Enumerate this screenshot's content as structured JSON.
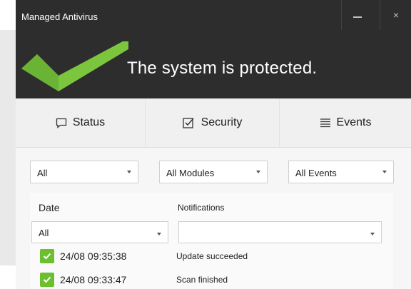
{
  "window": {
    "title": "Managed Antivirus",
    "minimize_label": "",
    "close_label": "×"
  },
  "banner": {
    "status_text": "The system is protected.",
    "accent": "#7cc63e"
  },
  "tabs": [
    {
      "label": "Status",
      "icon": "speech-bubble-icon"
    },
    {
      "label": "Security",
      "icon": "checkbox-icon"
    },
    {
      "label": "Events",
      "icon": "list-icon"
    }
  ],
  "filters": {
    "time": "All",
    "modules": "All Modules",
    "events": "All Events"
  },
  "table": {
    "headers": {
      "date": "Date",
      "notifications": "Notifications"
    },
    "date_filter": "All",
    "notification_filter": "",
    "rows": [
      {
        "date": "24/08 09:35:38",
        "message": "Update succeeded",
        "icon": "check-icon"
      },
      {
        "date": "24/08 09:33:47",
        "message": "Scan finished",
        "icon": "check-icon"
      }
    ]
  }
}
